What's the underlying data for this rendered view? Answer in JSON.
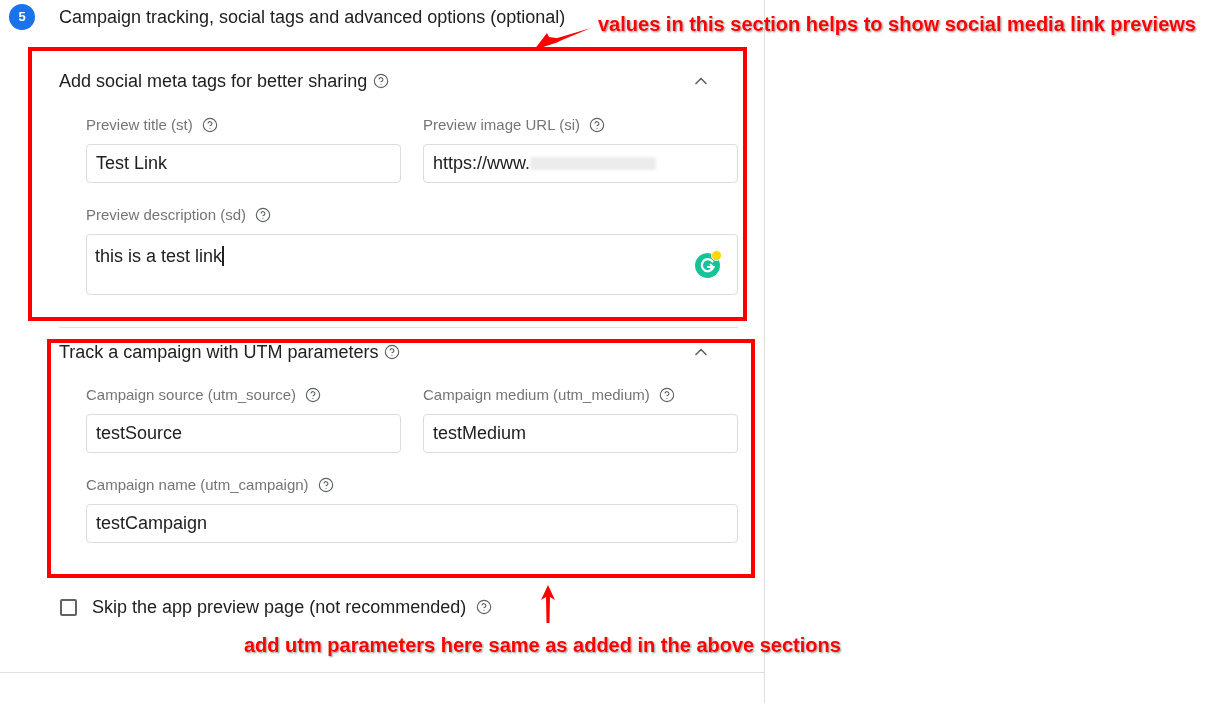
{
  "step": {
    "number": "5",
    "title": "Campaign tracking, social tags and advanced options (optional)"
  },
  "sections": [
    {
      "title": "Add social meta tags for better sharing",
      "expanded": true,
      "highlighted": true,
      "fields": [
        {
          "kind": "input",
          "label": "Preview title (st)",
          "value": "Test Link"
        },
        {
          "kind": "input",
          "label": "Preview image URL (si)",
          "value": "https://www.",
          "redacted": true
        },
        {
          "kind": "textarea",
          "label": "Preview description (sd)",
          "value": "this is a test link",
          "focused": true
        }
      ]
    },
    {
      "title": "Track a campaign with UTM parameters",
      "expanded": true,
      "highlighted": true,
      "fields": [
        {
          "kind": "input",
          "label": "Campaign source (utm_source)",
          "value": "testSource"
        },
        {
          "kind": "input",
          "label": "Campaign medium (utm_medium)",
          "value": "testMedium"
        },
        {
          "kind": "input",
          "label": "Campaign name (utm_campaign)",
          "value": "testCampaign"
        }
      ]
    }
  ],
  "skip_preview": {
    "label": "Skip the app preview page (not recommended)",
    "checked": false
  },
  "callouts": [
    {
      "text": "values in this section helps to show social media link previews"
    },
    {
      "text": "add utm parameters here same as added in the above sections"
    }
  ]
}
